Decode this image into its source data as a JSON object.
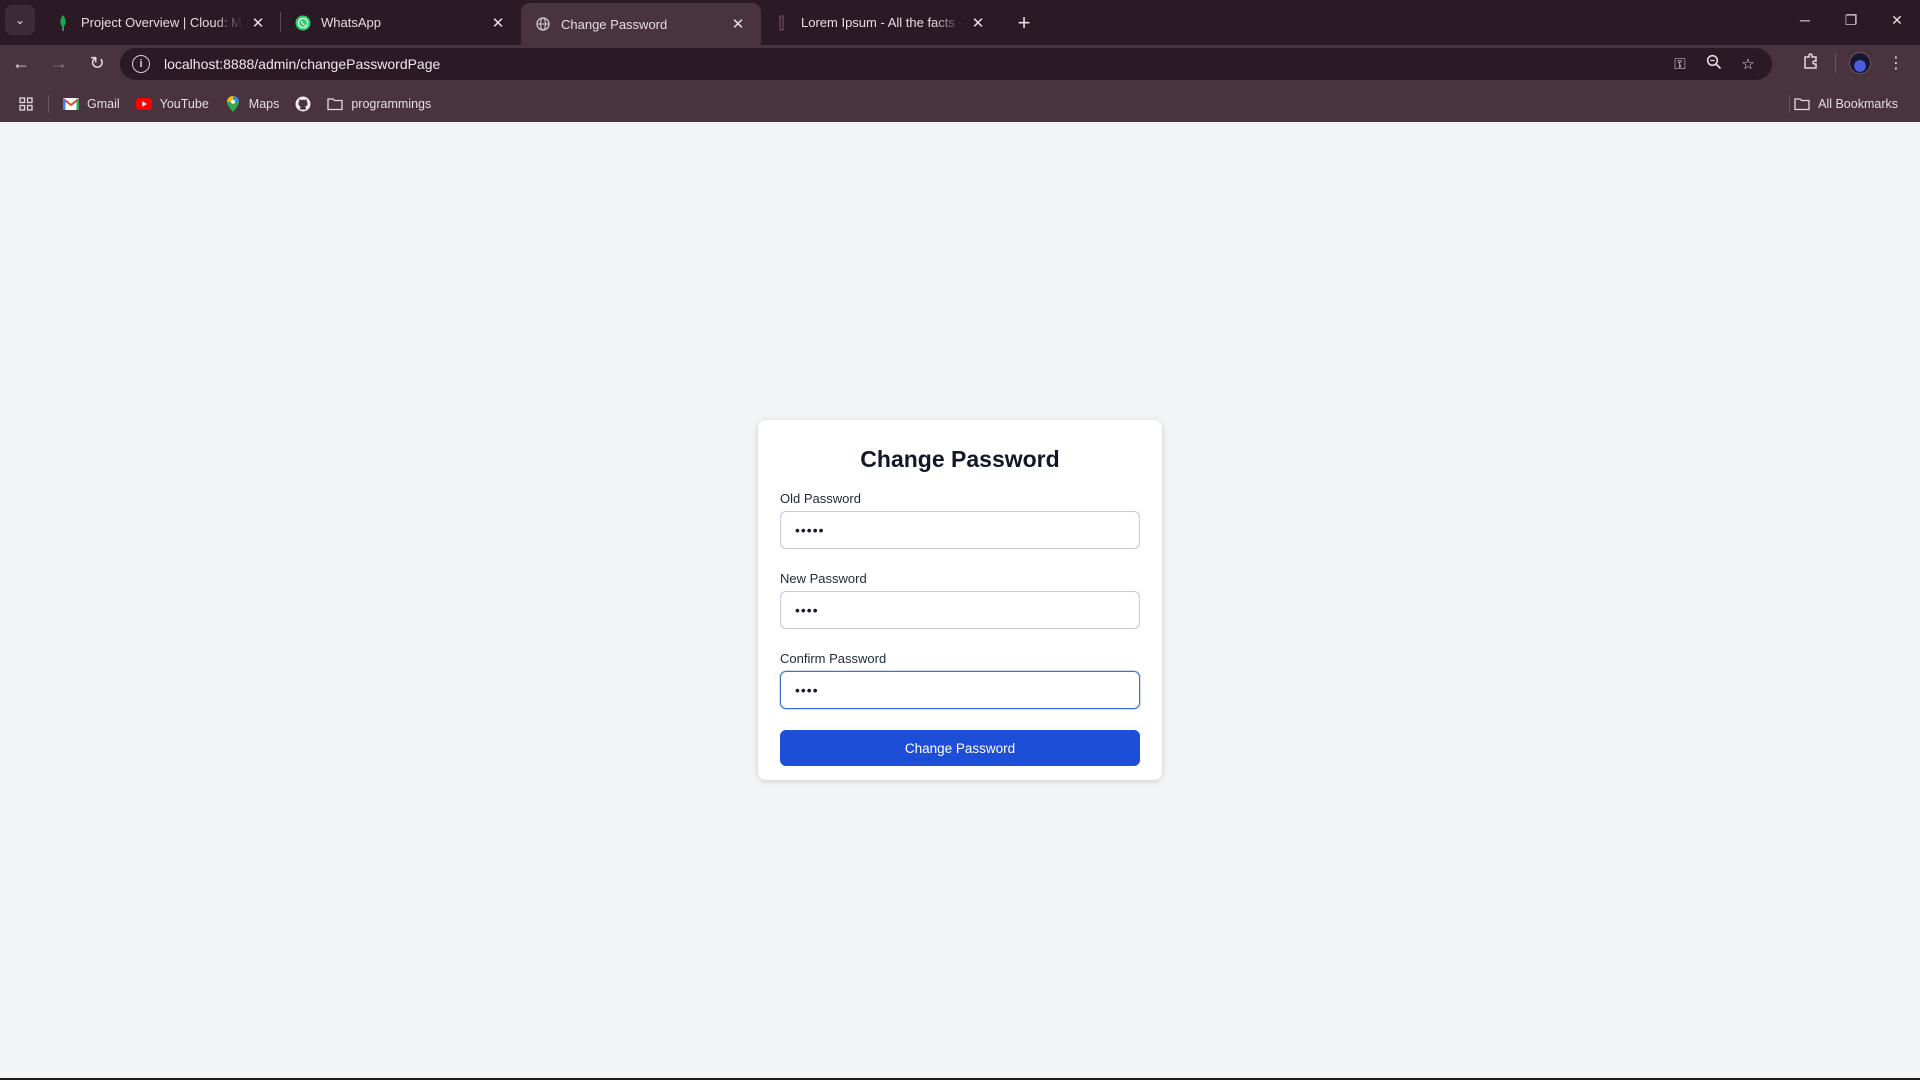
{
  "browser": {
    "tabs": [
      {
        "title": "Project Overview | Cloud: MongoDB",
        "icon": "mongodb-leaf-icon",
        "active": false
      },
      {
        "title": "WhatsApp",
        "icon": "whatsapp-icon",
        "active": false
      },
      {
        "title": "Change Password",
        "icon": "globe-icon",
        "active": true
      },
      {
        "title": "Lorem Ipsum - All the facts - Lipsum",
        "icon": "lipsum-icon",
        "active": false
      }
    ],
    "url": "localhost:8888/admin/changePasswordPage",
    "bookmarks": [
      {
        "label": "Gmail",
        "icon": "gmail-icon"
      },
      {
        "label": "YouTube",
        "icon": "youtube-icon"
      },
      {
        "label": "Maps",
        "icon": "maps-icon"
      },
      {
        "label": "",
        "icon": "github-icon"
      },
      {
        "label": "programmings",
        "icon": "folder-icon"
      }
    ],
    "all_bookmarks_label": "All Bookmarks",
    "colors": {
      "frame": "#2b1a26",
      "toolbar": "#48333f"
    }
  },
  "form": {
    "title": "Change Password",
    "old_password": {
      "label": "Old Password",
      "value": "•••••"
    },
    "new_password": {
      "label": "New Password",
      "value": "••••"
    },
    "confirm_password": {
      "label": "Confirm Password",
      "value": "••••"
    },
    "submit_label": "Change Password",
    "colors": {
      "button": "#1d4ed8",
      "page_bg": "#f3f4f6"
    }
  }
}
